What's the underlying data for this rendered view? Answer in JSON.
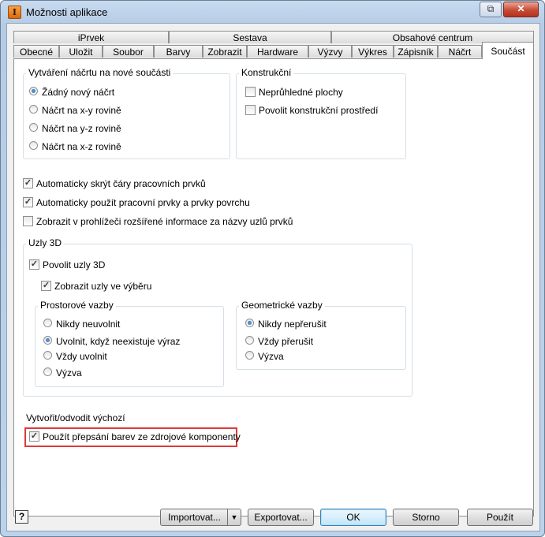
{
  "window": {
    "title": "Možnosti aplikace",
    "app_icon": "I",
    "buttons": {
      "restore_glyph": "⧉",
      "close_glyph": "✕"
    }
  },
  "tabs": {
    "row_back": [
      "iPrvek",
      "Sestava",
      "Obsahové centrum"
    ],
    "row_front": [
      "Obecné",
      "Uložit",
      "Soubor",
      "Barvy",
      "Zobrazit",
      "Hardware",
      "Výzvy",
      "Výkres",
      "Zápisník",
      "Náčrt",
      "Součást"
    ],
    "active": "Součást"
  },
  "sketch_group": {
    "label": "Vytváření náčrtu na nové součásti",
    "options": [
      {
        "label": "Žádný nový náčrt",
        "selected": true
      },
      {
        "label": "Náčrt na x-y rovině",
        "selected": false
      },
      {
        "label": "Náčrt na y-z rovině",
        "selected": false
      },
      {
        "label": "Náčrt na x-z rovině",
        "selected": false
      }
    ]
  },
  "construction_group": {
    "label": "Konstrukční",
    "options": [
      {
        "label": "Neprůhledné plochy",
        "checked": false
      },
      {
        "label": "Povolit konstrukční prostředí",
        "checked": false
      }
    ]
  },
  "general_checks": [
    {
      "label": "Automaticky skrýt čáry pracovních prvků",
      "checked": true
    },
    {
      "label": "Automaticky použít pracovní prvky a prvky povrchu",
      "checked": true
    },
    {
      "label": "Zobrazit v prohlížeči rozšířené informace za názvy uzlů prvků",
      "checked": false
    }
  ],
  "nodes3d": {
    "label": "Uzly 3D",
    "enable": {
      "label": "Povolit uzly 3D",
      "checked": true
    },
    "show_in_selection": {
      "label": "Zobrazit uzly ve výběru",
      "checked": true
    },
    "spatial": {
      "label": "Prostorové vazby",
      "options": [
        {
          "label": "Nikdy neuvolnit",
          "selected": false
        },
        {
          "label": "Uvolnit, když neexistuje výraz",
          "selected": true
        },
        {
          "label": "Vždy uvolnit",
          "selected": false
        },
        {
          "label": "Výzva",
          "selected": false
        }
      ]
    },
    "geometric": {
      "label": "Geometrické vazby",
      "options": [
        {
          "label": "Nikdy nepřerušit",
          "selected": true
        },
        {
          "label": "Vždy přerušit",
          "selected": false
        },
        {
          "label": "Výzva",
          "selected": false
        }
      ]
    }
  },
  "derive": {
    "label": "Vytvořit/odvodit výchozí",
    "option": {
      "label": "Použít přepsání barev ze zdrojové komponenty",
      "checked": true
    },
    "highlight_color": "#e03a3a"
  },
  "footer": {
    "help_glyph": "?",
    "import_label": "Importovat...",
    "export_label": "Exportovat...",
    "ok_label": "OK",
    "cancel_label": "Storno",
    "apply_label": "Použít"
  }
}
